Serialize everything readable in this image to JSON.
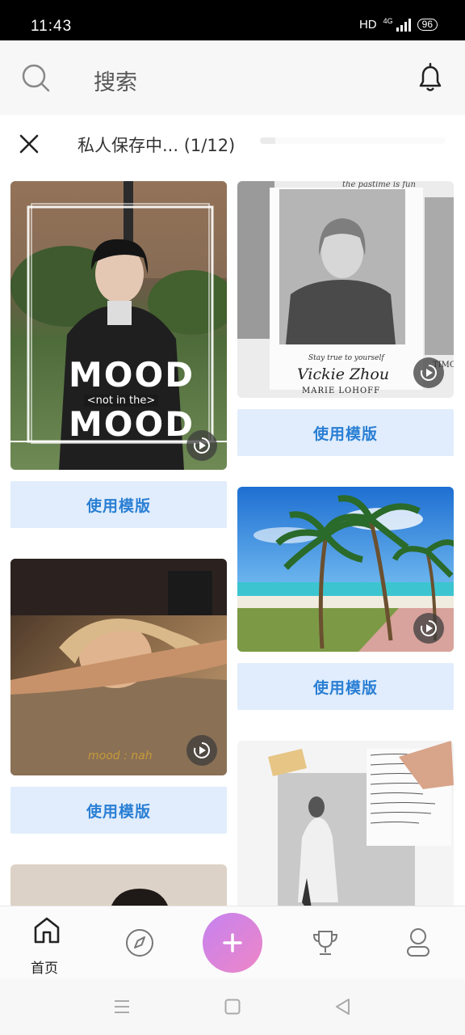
{
  "status_bar": {
    "time": "11:43",
    "hd": "HD",
    "network": "4G",
    "battery": "96"
  },
  "search": {
    "placeholder": "搜索"
  },
  "save_bar": {
    "status": "私人保存中... (1/12)",
    "progress_fraction": 0.083
  },
  "templates": [
    {
      "overlay_text": "MOOD",
      "overlay_sub": "<not in the>",
      "button": "使用模版"
    },
    {
      "overlay_text": "Vickie Zhou",
      "caption": "Stay true to yourself",
      "name_line": "MARIE LOHOFF",
      "top_line": "the pastime is fun",
      "side_text": "TIMO",
      "button": "使用模版"
    },
    {
      "button": "使用模版"
    },
    {
      "overlay_text": "mood : nah",
      "button": "使用模版"
    }
  ],
  "bottom_nav": {
    "home_label": "首页"
  },
  "colors": {
    "accent": "#2a7fd4",
    "button_bg": "#e1edfc",
    "fab_start": "#c582f0",
    "fab_end": "#ee86c6"
  },
  "icons": [
    "search-icon",
    "bell-icon",
    "close-icon",
    "play-icon",
    "home-icon",
    "compass-icon",
    "plus-icon",
    "trophy-icon",
    "profile-icon",
    "menu-icon",
    "square-icon",
    "back-icon"
  ]
}
